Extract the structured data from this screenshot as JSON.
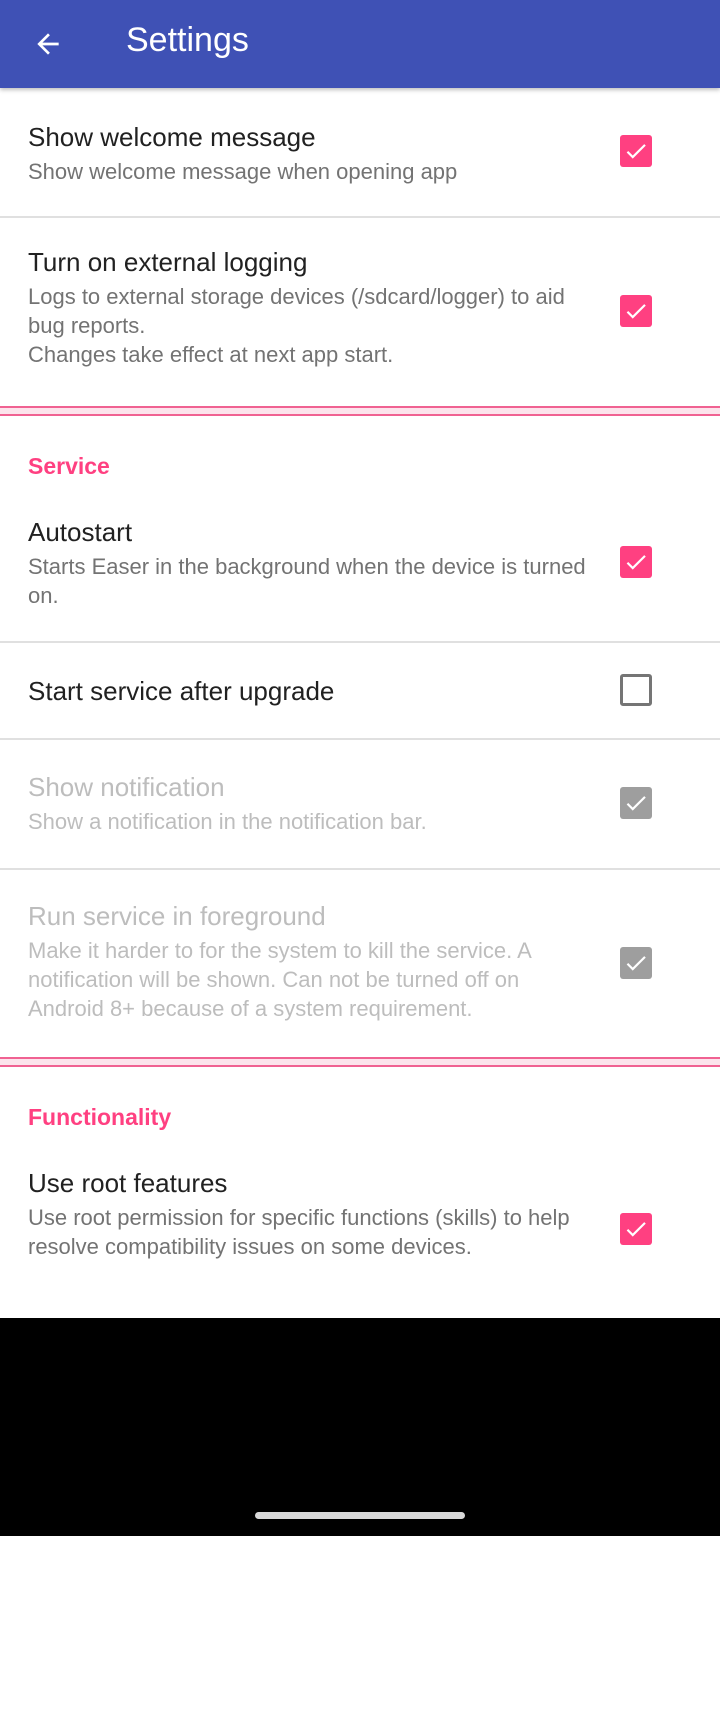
{
  "appbar": {
    "title": "Settings"
  },
  "general": {
    "welcome": {
      "title": "Show welcome message",
      "summary": "Show welcome message when opening app",
      "checked": true
    },
    "logging": {
      "title": "Turn on external logging",
      "summary": "Logs to external storage devices (/sdcard/logger) to aid bug reports.\nChanges take effect at next app start.",
      "checked": true
    }
  },
  "service": {
    "header": "Service",
    "autostart": {
      "title": "Autostart",
      "summary": "Starts Easer in the background when the device is turned on.",
      "checked": true
    },
    "start_after_upgrade": {
      "title": "Start service after upgrade",
      "checked": false
    },
    "show_notification": {
      "title": "Show notification",
      "summary": "Show a notification in the notification bar.",
      "checked": true,
      "enabled": false
    },
    "foreground": {
      "title": "Run service in foreground",
      "summary": "Make it harder to for the system to kill the service. A notification will be shown. Can not be turned off on Android 8+ because of a system requirement.",
      "checked": true,
      "enabled": false
    }
  },
  "functionality": {
    "header": "Functionality",
    "root": {
      "title": "Use root features",
      "summary": "Use root permission for specific functions (skills) to help resolve compatibility issues on some devices.",
      "checked": true
    }
  },
  "colors": {
    "primary": "#3F51B5",
    "accent": "#FF4081",
    "disabled": "#BDBDBD"
  }
}
